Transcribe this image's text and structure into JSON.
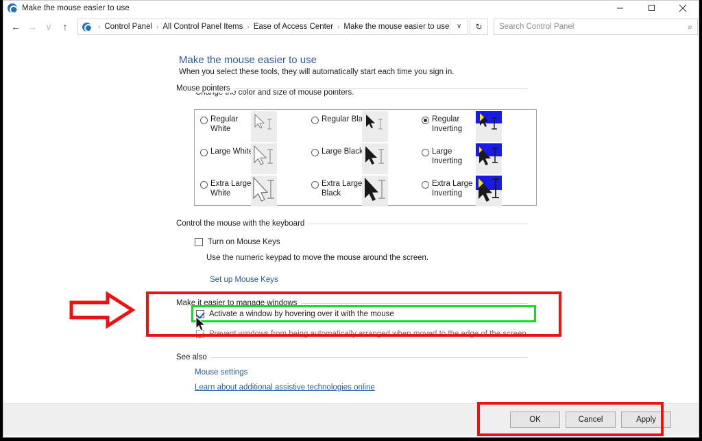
{
  "window": {
    "title": "Make the mouse easier to use",
    "app_icon": "control-panel-icon",
    "minimize_label": "–",
    "maximize_label": "❐",
    "close_label": "✕"
  },
  "addressbar": {
    "back_icon": "←",
    "forward_icon": "→",
    "recent_icon": "∨",
    "up_icon": "↑",
    "breadcrumbs": [
      "Control Panel",
      "All Control Panel Items",
      "Ease of Access Center",
      "Make the mouse easier to use"
    ],
    "separator": "›",
    "dropdown_icon": "∨",
    "refresh_icon": "↻",
    "search_placeholder": "Search Control Panel",
    "search_value": "",
    "search_icon": "⌕"
  },
  "page": {
    "heading": "Make the mouse easier to use",
    "subheading": "When you select these tools, they will automatically start each time you sign in."
  },
  "sections": {
    "pointers": {
      "label": "Mouse pointers",
      "description": "Change the color and size of mouse pointers.",
      "options": [
        {
          "label": "Regular White",
          "selected": false,
          "style": "white",
          "size": "regular"
        },
        {
          "label": "Large White",
          "selected": false,
          "style": "white",
          "size": "large"
        },
        {
          "label": "Extra Large White",
          "selected": false,
          "style": "white",
          "size": "xlarge"
        },
        {
          "label": "Regular Black",
          "selected": false,
          "style": "black",
          "size": "regular"
        },
        {
          "label": "Large Black",
          "selected": false,
          "style": "black",
          "size": "large"
        },
        {
          "label": "Extra Large Black",
          "selected": false,
          "style": "black",
          "size": "xlarge"
        },
        {
          "label": "Regular Inverting",
          "selected": true,
          "style": "inverting",
          "size": "regular"
        },
        {
          "label": "Large Inverting",
          "selected": false,
          "style": "inverting",
          "size": "large"
        },
        {
          "label": "Extra Large Inverting",
          "selected": false,
          "style": "inverting",
          "size": "xlarge"
        }
      ]
    },
    "keyboard": {
      "label": "Control the mouse with the keyboard",
      "checkbox_label": "Turn on Mouse Keys",
      "checkbox_checked": false,
      "hint": "Use the numeric keypad to move the mouse around the screen.",
      "link": "Set up Mouse Keys"
    },
    "windows": {
      "label": "Make it easier to manage windows",
      "checkbox1_label": "Activate a window by hovering over it with the mouse",
      "checkbox1_checked": true,
      "checkbox2_label": "Prevent windows from being automatically arranged when moved to the edge of the screen",
      "checkbox2_checked": true
    },
    "see_also": {
      "label": "See also",
      "links": [
        "Mouse settings",
        "Learn about additional assistive technologies online"
      ]
    }
  },
  "footer": {
    "ok": "OK",
    "cancel": "Cancel",
    "apply": "Apply"
  },
  "annotations": {
    "arrow_color": "#ee1111",
    "rect_color": "#ee1111",
    "highlight_color": "#11dd22",
    "arrow_name": "red-arrow-annotation"
  },
  "colors": {
    "accent_link": "#2a5a99",
    "inverting_blue": "#1a1ae6",
    "inverting_yellow": "#ffe600",
    "footer_bg": "#efefef"
  }
}
